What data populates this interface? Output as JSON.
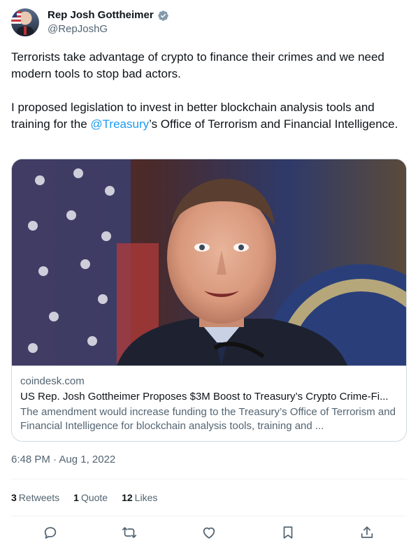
{
  "author": {
    "name": "Rep Josh Gottheimer",
    "handle": "@RepJoshG",
    "verified_color": "#829aab"
  },
  "tweet": {
    "paragraph1": "Terrorists take advantage of crypto to finance their crimes and we need modern tools to stop bad actors.",
    "paragraph2_before": "I proposed legislation to invest in better blockchain analysis tools and training for the ",
    "mention": "@Treasury",
    "paragraph2_after": "’s Office of Terrorism and Financial Intelligence."
  },
  "card": {
    "domain": "coindesk.com",
    "title": "US Rep. Josh Gottheimer Proposes $3M Boost to Treasury’s Crypto Crime-Fi...",
    "description": "The amendment would increase funding to the Treasury’s Office of Terrorism and Financial Intelligence for blockchain analysis tools, training and ..."
  },
  "timestamp": "6:48 PM · Aug 1, 2022",
  "stats": {
    "retweets": {
      "count": "3",
      "label": "Retweets"
    },
    "quotes": {
      "count": "1",
      "label": "Quote"
    },
    "likes": {
      "count": "12",
      "label": "Likes"
    }
  },
  "actions": {
    "reply_icon": "reply-icon",
    "retweet_icon": "retweet-icon",
    "like_icon": "heart-icon",
    "bookmark_icon": "bookmark-icon",
    "share_icon": "share-icon"
  },
  "colors": {
    "link": "#1d9bf0",
    "secondary_text": "#536471",
    "border": "#cfd9de"
  }
}
